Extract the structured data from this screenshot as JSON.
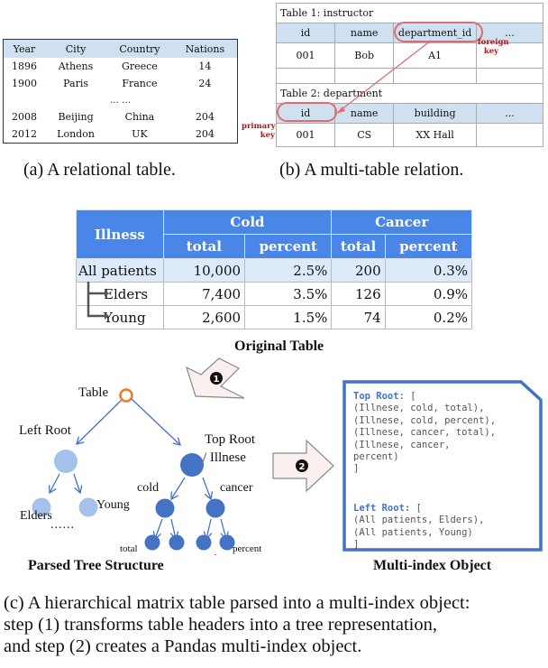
{
  "panel_a": {
    "columns": [
      "Year",
      "City",
      "Country",
      "Nations"
    ],
    "rows": [
      [
        "1896",
        "Athens",
        "Greece",
        "14"
      ],
      [
        "1900",
        "Paris",
        "France",
        "24"
      ],
      [
        "2008",
        "Beijing",
        "China",
        "204"
      ],
      [
        "2012",
        "London",
        "UK",
        "204"
      ]
    ],
    "ellipsis": "… …",
    "caption": "(a) A relational table."
  },
  "panel_b": {
    "table1": {
      "title": "Table 1: instructor",
      "columns": [
        "id",
        "name",
        "department_id",
        "..."
      ],
      "row": [
        "001",
        "Bob",
        "A1",
        ""
      ]
    },
    "table2": {
      "title": "Table 2: department",
      "columns": [
        "id",
        "name",
        "building",
        "..."
      ],
      "row": [
        "001",
        "CS",
        "XX Hall",
        ""
      ]
    },
    "foreign_key_label": [
      "foreign",
      "key"
    ],
    "primary_key_label": [
      "primary",
      "key"
    ],
    "highlight_color": "#e06c6c",
    "caption": "(b) A multi-table relation."
  },
  "panel_c": {
    "table": {
      "corner": "Illness",
      "groups": [
        "Cold",
        "Cancer"
      ],
      "subcolumns": [
        "total",
        "percent",
        "total",
        "percent"
      ],
      "rows": [
        {
          "label": "All patients",
          "values": [
            "10,000",
            "2.5%",
            "200",
            "0.3%"
          ]
        },
        {
          "label": "Elders",
          "values": [
            "7,400",
            "3.5%",
            "126",
            "0.9%"
          ]
        },
        {
          "label": "Young",
          "values": [
            "2,600",
            "1.5%",
            "74",
            "0.2%"
          ]
        }
      ],
      "header_color": "#4a86e8",
      "title": "Original Table"
    },
    "step1_label": "1",
    "step2_label": "2",
    "tree": {
      "title": "Parsed Tree Structure",
      "root": "Table",
      "left_root": "Left Root",
      "left_children": [
        "Elders",
        "Young"
      ],
      "left_more": "......",
      "top_root": [
        "Top Root",
        "/ Illnese"
      ],
      "top_children": [
        "cold",
        "cancer"
      ],
      "leaves": [
        "total",
        "percent",
        "total",
        "percent"
      ],
      "root_color": "#f07a22",
      "left_color": "#a4c2ea",
      "top_color": "#4472c4"
    },
    "multi_index": {
      "title": "Multi-index Object",
      "top_root_key": "Top Root",
      "top_root_lines": [
        "(Illnese, cold, total),",
        "(Illnese, cold, percent),",
        "(Illnese, cancer, total),",
        "(Illnese, cancer,",
        "percent)",
        "]"
      ],
      "left_root_key": "Left Root",
      "left_root_lines": [
        "(All patients, Elders),",
        "(All patients, Young)",
        "]"
      ],
      "border_color": "#4472c4"
    },
    "caption_lines": [
      "(c) A hierarchical matrix table parsed into a multi-index object:",
      "step (1) transforms table headers into a tree representation,",
      "and step (2) creates a Pandas multi-index object."
    ]
  }
}
